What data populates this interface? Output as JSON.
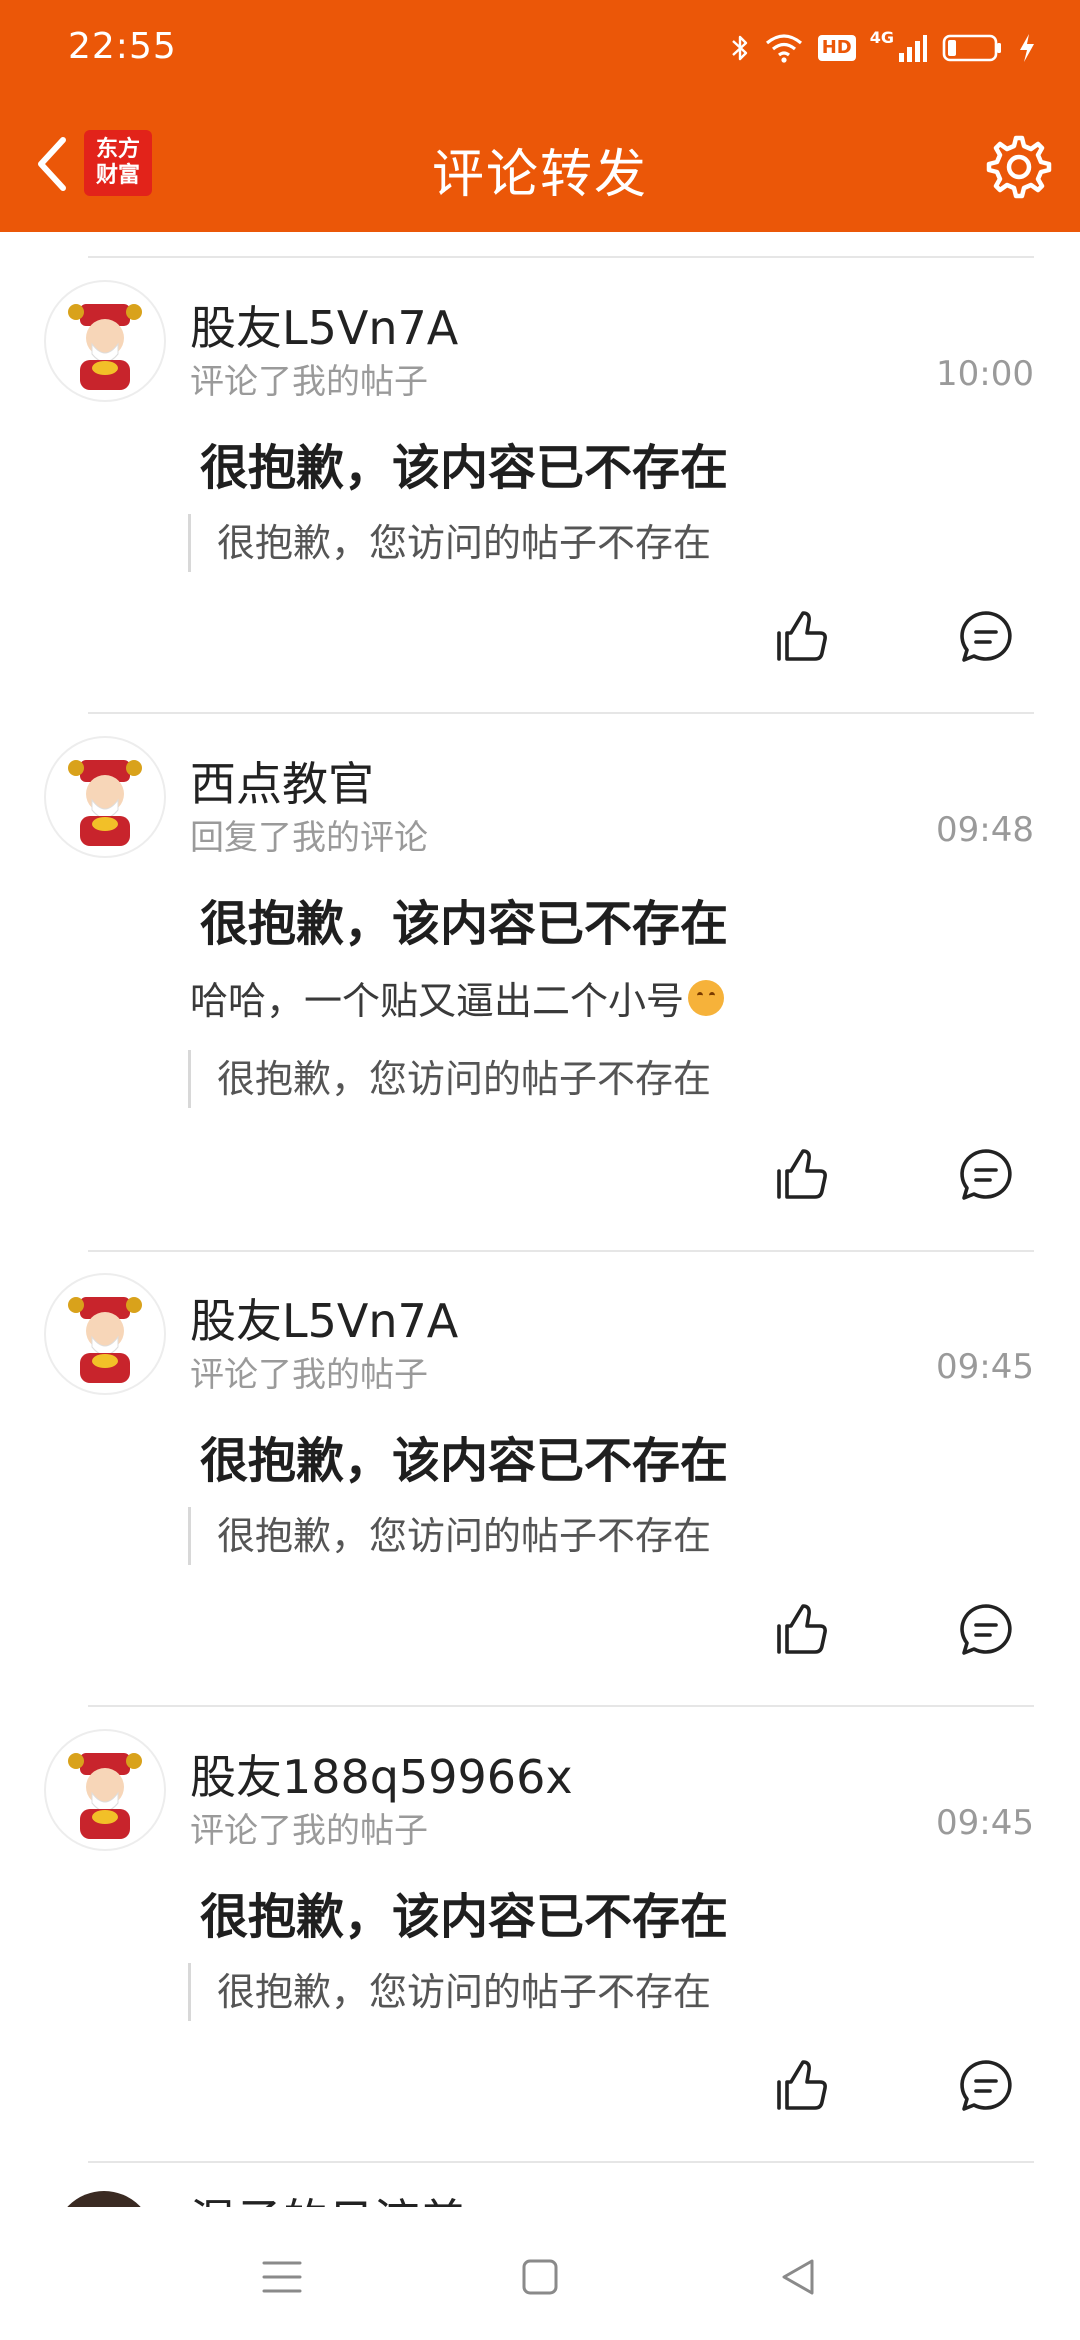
{
  "status_bar": {
    "time": "22:55",
    "hd_label": "HD",
    "network_label": "4G",
    "icons": [
      "bluetooth-icon",
      "wifi-icon",
      "hd-icon",
      "signal-icon",
      "battery-icon",
      "charging-icon"
    ]
  },
  "header": {
    "title": "评论转发",
    "logo_line1": "东方",
    "logo_line2": "财富",
    "back_icon": "chevron-left-icon",
    "settings_icon": "gear-icon"
  },
  "colors": {
    "brand": "#eb5708",
    "logo_red": "#e2231a",
    "secondary_text": "#9a9a9a",
    "divider": "#e6e6e6"
  },
  "items": [
    {
      "username": "股友L5Vn7A",
      "action": "评论了我的帖子",
      "time": "10:00",
      "headline": "很抱歉，该内容已不存在",
      "reply": "",
      "quote": "很抱歉，您访问的帖子不存在"
    },
    {
      "username": "西点教官",
      "action": "回复了我的评论",
      "time": "09:48",
      "headline": "很抱歉，该内容已不存在",
      "reply": "哈哈，一个贴又逼出二个小号",
      "quote": "很抱歉，您访问的帖子不存在"
    },
    {
      "username": "股友L5Vn7A",
      "action": "评论了我的帖子",
      "time": "09:45",
      "headline": "很抱歉，该内容已不存在",
      "reply": "",
      "quote": "很抱歉，您访问的帖子不存在"
    },
    {
      "username": "股友188q59966x",
      "action": "评论了我的帖子",
      "time": "09:45",
      "headline": "很抱歉，该内容已不存在",
      "reply": "",
      "quote": "很抱歉，您访问的帖子不存在"
    }
  ],
  "partial_item": {
    "username": "混孑的日流差"
  },
  "system_nav": {
    "icons": [
      "menu-icon",
      "home-square-icon",
      "back-triangle-icon"
    ]
  }
}
